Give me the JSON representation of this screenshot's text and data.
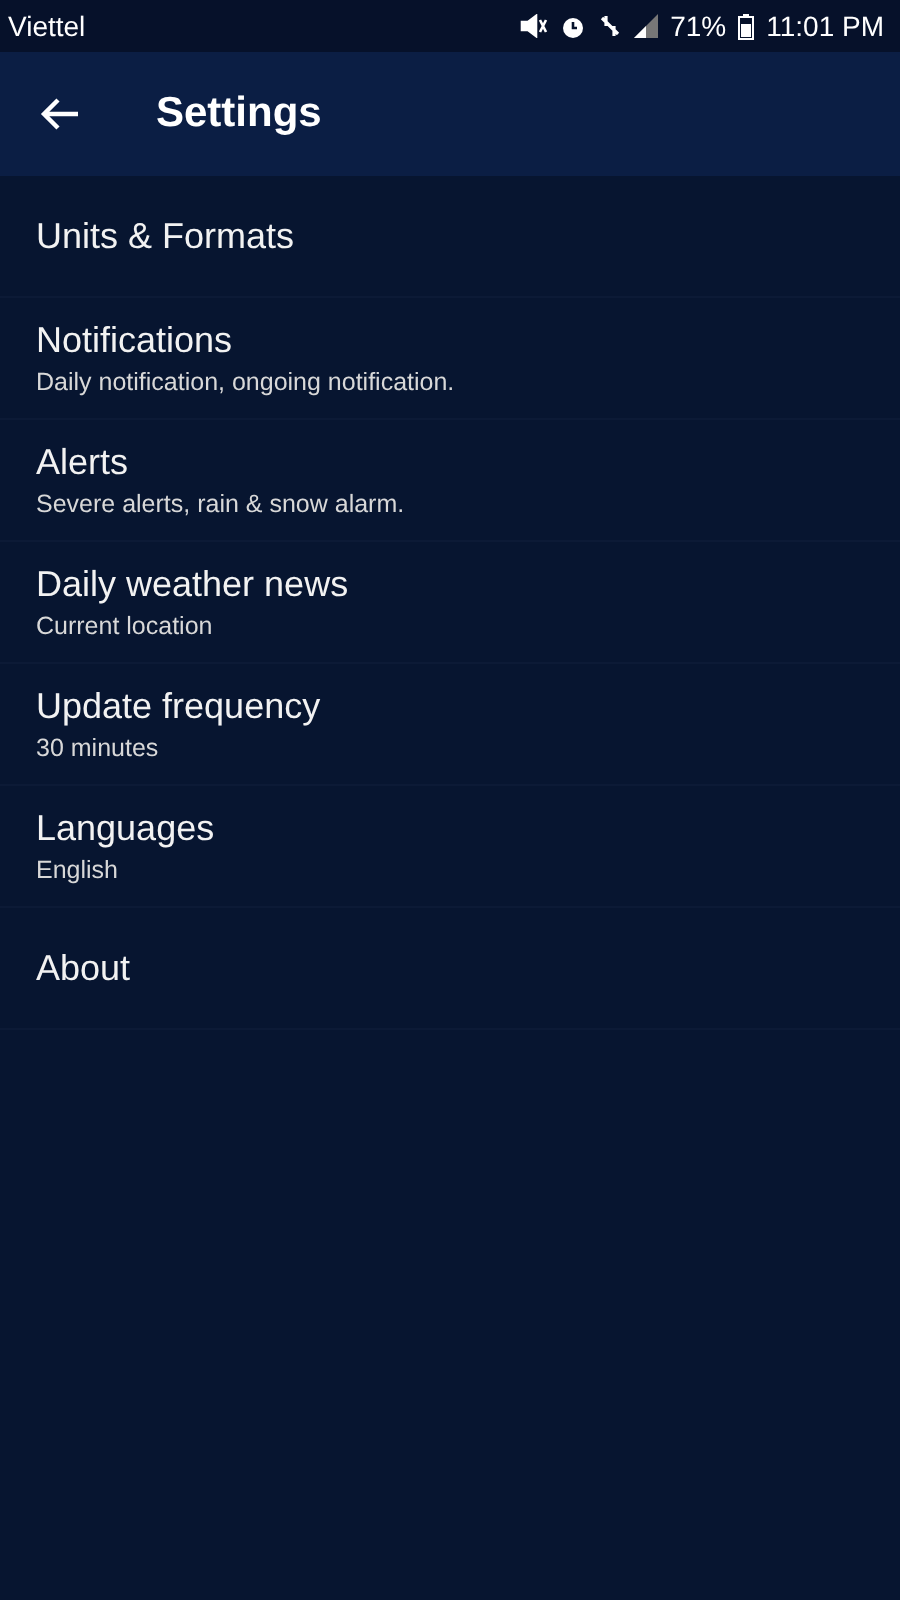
{
  "status_bar": {
    "carrier": "Viettel",
    "battery": "71%",
    "time": "11:01 PM"
  },
  "app_bar": {
    "title": "Settings"
  },
  "items": [
    {
      "title": "Units & Formats"
    },
    {
      "title": "Notifications",
      "subtitle": "Daily notification, ongoing notification."
    },
    {
      "title": "Alerts",
      "subtitle": "Severe alerts, rain & snow alarm."
    },
    {
      "title": "Daily weather news",
      "subtitle": "Current location"
    },
    {
      "title": "Update frequency",
      "subtitle": "30 minutes"
    },
    {
      "title": "Languages",
      "subtitle": "English"
    },
    {
      "title": "About"
    }
  ]
}
